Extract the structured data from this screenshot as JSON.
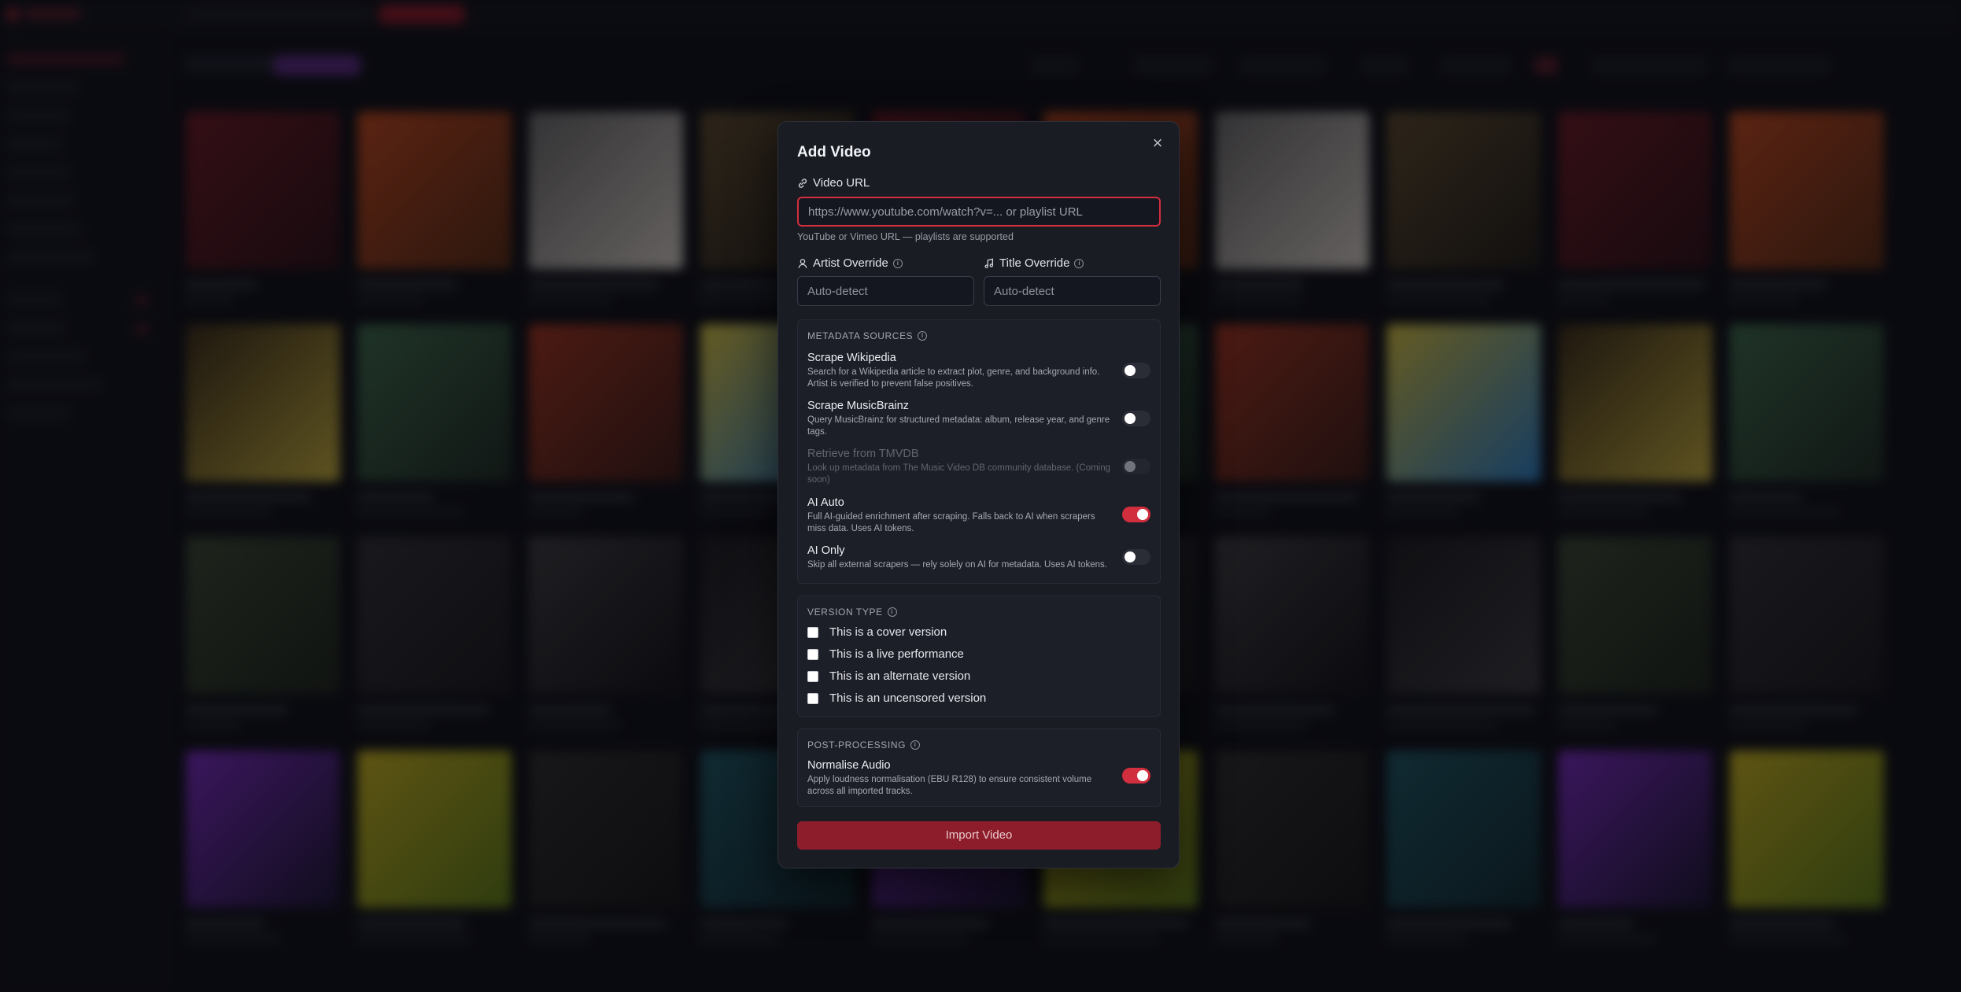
{
  "modal": {
    "title": "Add Video",
    "video_url": {
      "label": "Video URL",
      "placeholder": "https://www.youtube.com/watch?v=... or playlist URL",
      "value": "",
      "hint": "YouTube or Vimeo URL — playlists are supported"
    },
    "artist_override": {
      "label": "Artist Override",
      "placeholder": "Auto-detect",
      "value": ""
    },
    "title_override": {
      "label": "Title Override",
      "placeholder": "Auto-detect",
      "value": ""
    },
    "metadata_sources": {
      "title": "METADATA SOURCES",
      "options": [
        {
          "name": "Scrape Wikipedia",
          "desc": "Search for a Wikipedia article to extract plot, genre, and background info. Artist is verified to prevent false positives.",
          "state": "off"
        },
        {
          "name": "Scrape MusicBrainz",
          "desc": "Query MusicBrainz for structured metadata: album, release year, and genre tags.",
          "state": "off"
        },
        {
          "name": "Retrieve from TMVDB",
          "desc": "Look up metadata from The Music Video DB community database. (Coming soon)",
          "state": "disabled"
        },
        {
          "name": "AI Auto",
          "desc": "Full AI-guided enrichment after scraping. Falls back to AI when scrapers miss data. Uses AI tokens.",
          "state": "on"
        },
        {
          "name": "AI Only",
          "desc": "Skip all external scrapers — rely solely on AI for metadata. Uses AI tokens.",
          "state": "off"
        }
      ]
    },
    "version_type": {
      "title": "VERSION TYPE",
      "options": [
        {
          "label": "This is a cover version",
          "checked": false
        },
        {
          "label": "This is a live performance",
          "checked": false
        },
        {
          "label": "This is an alternate version",
          "checked": false
        },
        {
          "label": "This is an uncensored version",
          "checked": false
        }
      ]
    },
    "post_processing": {
      "title": "POST-PROCESSING",
      "options": [
        {
          "name": "Normalise Audio",
          "desc": "Apply loudness normalisation (EBU R128) to ensure consistent volume across all imported tracks.",
          "state": "on"
        }
      ]
    },
    "submit_label": "Import Video"
  },
  "colors": {
    "accent": "#d12e3e",
    "button": "#8d1d2a",
    "modal_bg": "#1a1c24",
    "page_bg": "#0d0e13"
  },
  "icons": {
    "close": "close-icon",
    "video_url": "link-icon",
    "artist": "user-icon",
    "title": "music-note-icon",
    "info": "info-icon"
  }
}
